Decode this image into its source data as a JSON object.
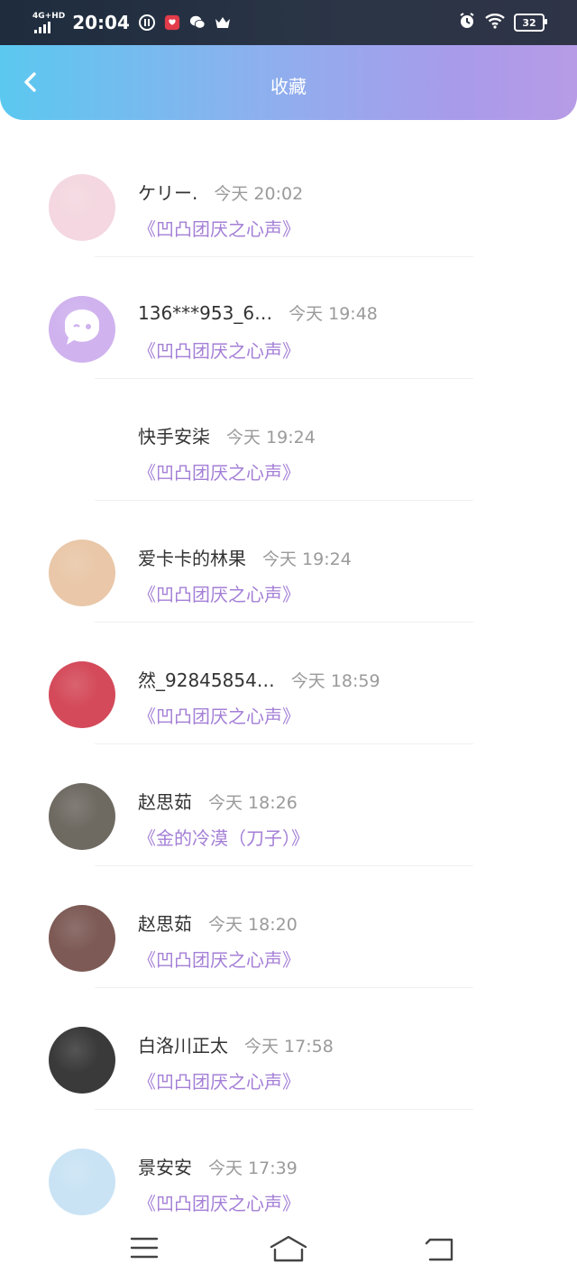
{
  "status_bar": {
    "network": "4G+HD",
    "time": "20:04",
    "battery": "32"
  },
  "header": {
    "title": "收藏"
  },
  "items": [
    {
      "name": "ケリー.",
      "time": "今天 20:02",
      "work": "《凹凸团厌之心声》",
      "avatar_color": "#f4d7e0"
    },
    {
      "name": "136***953_6…",
      "time": "今天 19:48",
      "work": "《凹凸团厌之心声》",
      "avatar_color": "#cfb2ee"
    },
    {
      "name": "快手安柒",
      "time": "今天 19:24",
      "work": "《凹凸团厌之心声》",
      "avatar_color": "#ffffff"
    },
    {
      "name": "爱卡卡的林果",
      "time": "今天 19:24",
      "work": "《凹凸团厌之心声》",
      "avatar_color": "#e9c7a8"
    },
    {
      "name": "然_92845854…",
      "time": "今天 18:59",
      "work": "《凹凸团厌之心声》",
      "avatar_color": "#d44a5a"
    },
    {
      "name": "赵思茹",
      "time": "今天 18:26",
      "work": "《金的冷漠（刀子）》",
      "avatar_color": "#6e6a62"
    },
    {
      "name": "赵思茹",
      "time": "今天 18:20",
      "work": "《凹凸团厌之心声》",
      "avatar_color": "#7d5a55"
    },
    {
      "name": "白洛川正太",
      "time": "今天 17:58",
      "work": "《凹凸团厌之心声》",
      "avatar_color": "#3a3a3a"
    },
    {
      "name": "景安安",
      "time": "今天 17:39",
      "work": "《凹凸团厌之心声》",
      "avatar_color": "#c9e3f4"
    }
  ],
  "nav": {
    "menu_icon": "menu-icon",
    "home_icon": "home-icon",
    "back_icon": "back-nav-icon"
  }
}
